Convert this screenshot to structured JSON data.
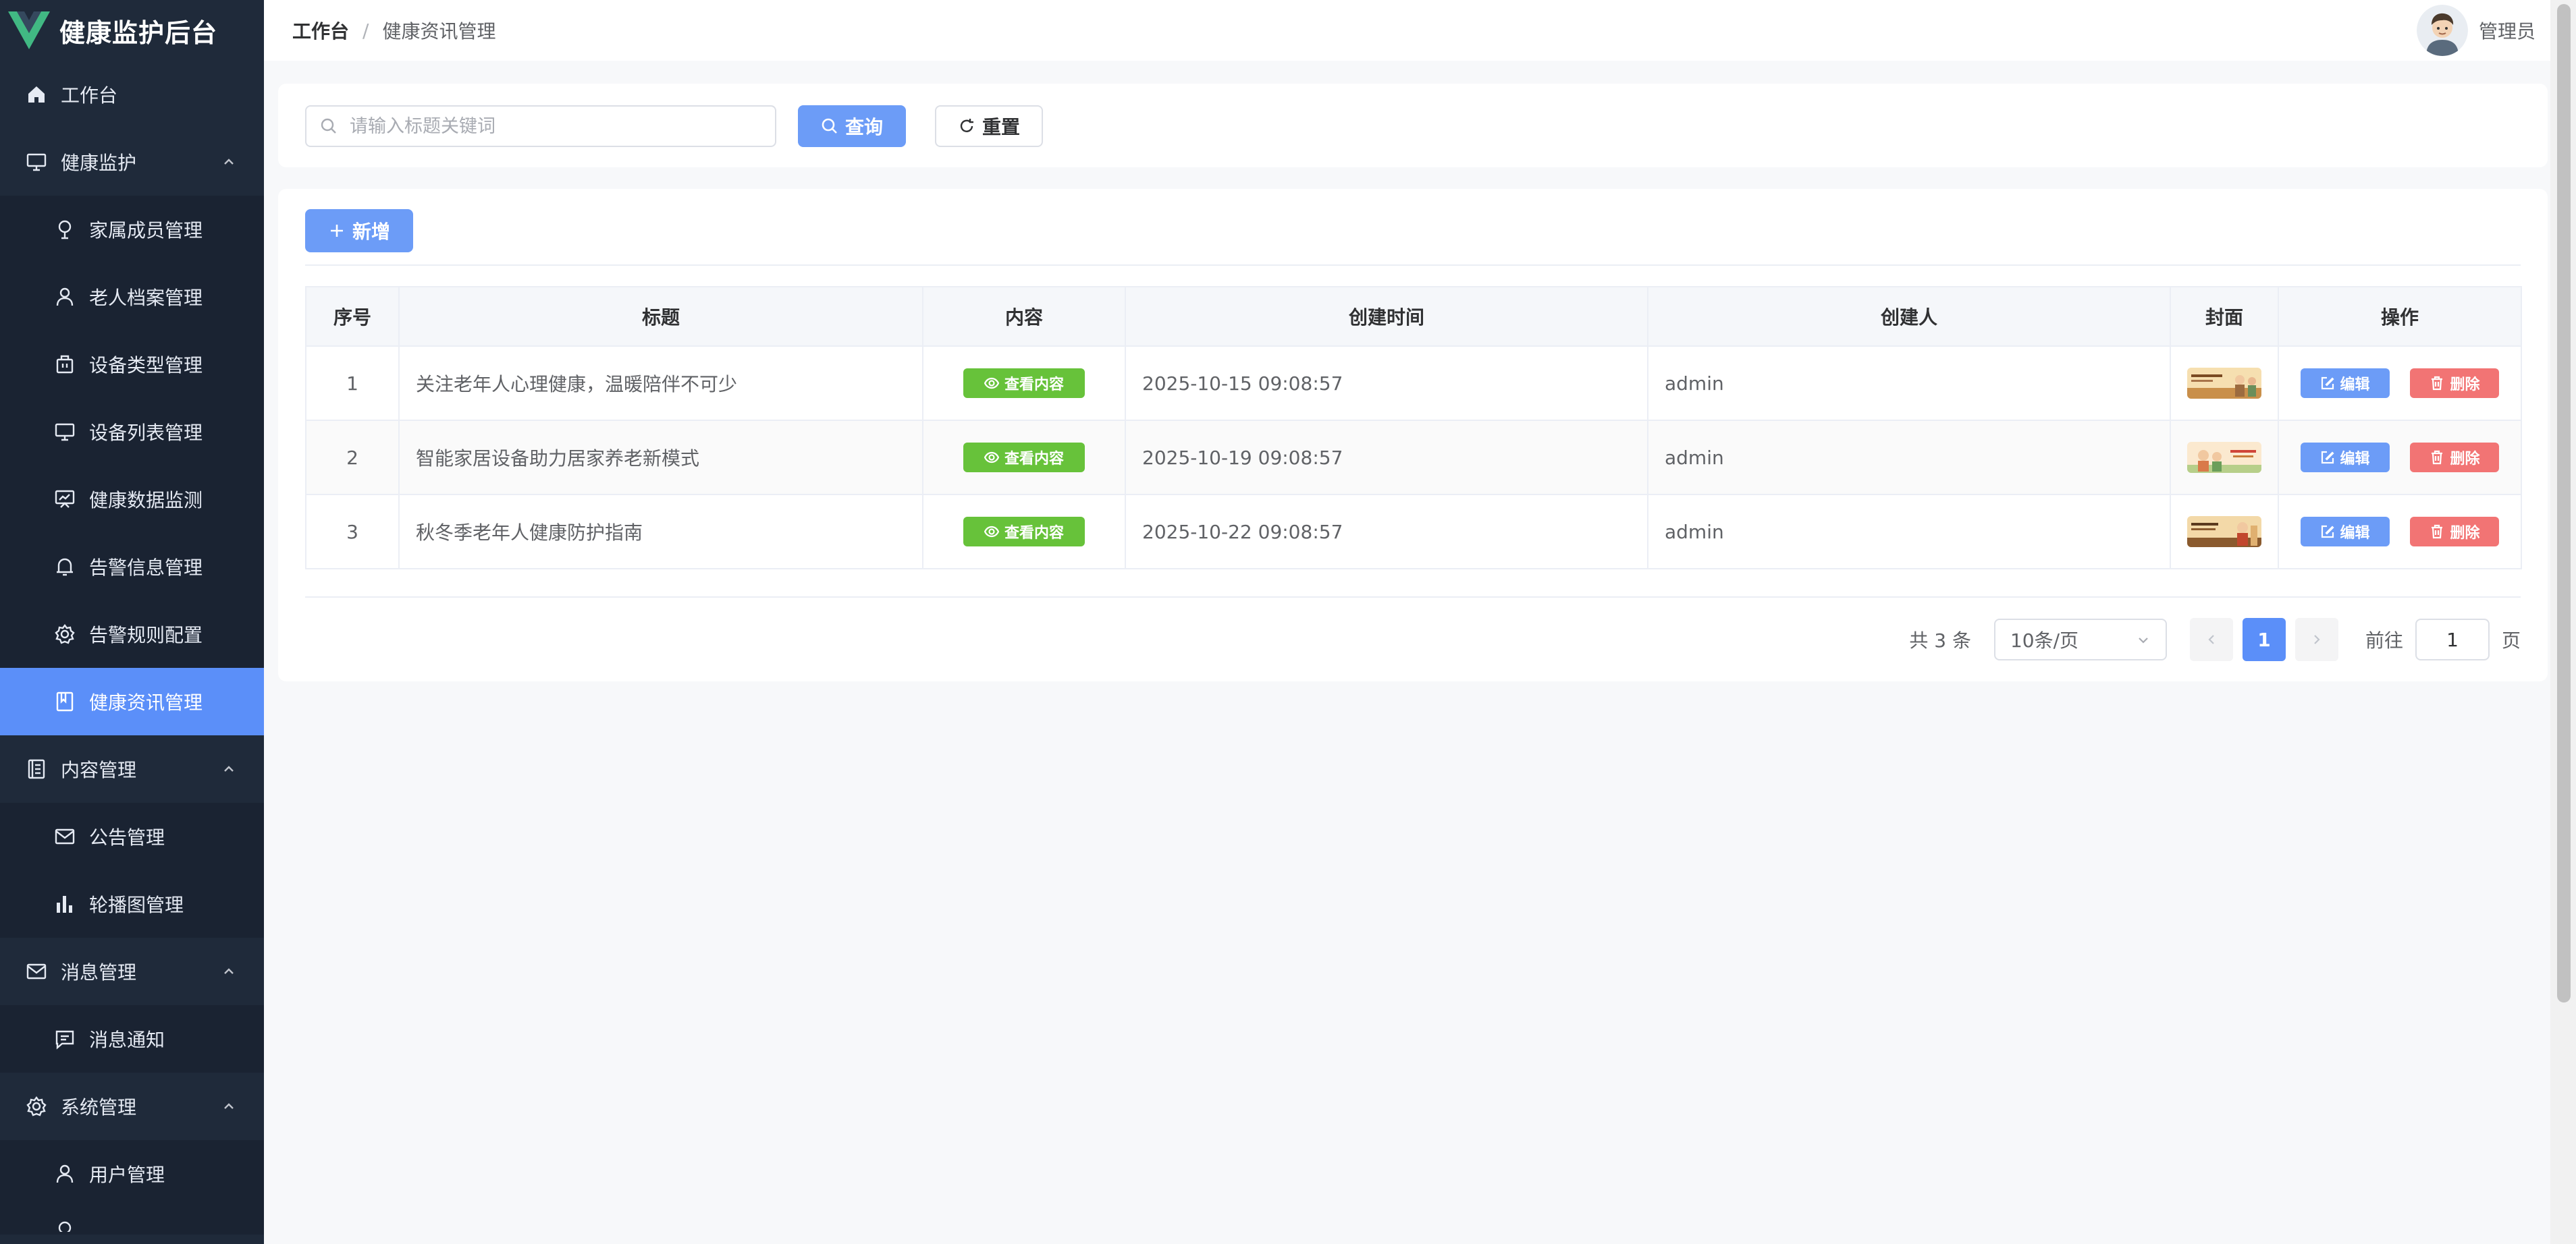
{
  "app": {
    "title": "健康监护后台"
  },
  "sidebar": {
    "items": [
      {
        "label": "工作台",
        "icon": "home-icon",
        "level": 1
      },
      {
        "label": "健康监护",
        "icon": "monitor-icon",
        "level": 1,
        "expanded": true
      },
      {
        "label": "家属成员管理",
        "icon": "location-pin-icon",
        "level": 2
      },
      {
        "label": "老人档案管理",
        "icon": "user-icon",
        "level": 2
      },
      {
        "label": "设备类型管理",
        "icon": "suitcase-icon",
        "level": 2
      },
      {
        "label": "设备列表管理",
        "icon": "monitor-icon",
        "level": 2
      },
      {
        "label": "健康数据监测",
        "icon": "data-board-icon",
        "level": 2
      },
      {
        "label": "告警信息管理",
        "icon": "bell-icon",
        "level": 2
      },
      {
        "label": "告警规则配置",
        "icon": "gear-icon",
        "level": 2
      },
      {
        "label": "健康资讯管理",
        "icon": "notebook-icon",
        "level": 2,
        "active": true
      },
      {
        "label": "内容管理",
        "icon": "document-icon",
        "level": 1,
        "expanded": true
      },
      {
        "label": "公告管理",
        "icon": "message-icon",
        "level": 2
      },
      {
        "label": "轮播图管理",
        "icon": "histogram-icon",
        "level": 2
      },
      {
        "label": "消息管理",
        "icon": "message-icon",
        "level": 1,
        "expanded": true
      },
      {
        "label": "消息通知",
        "icon": "chat-icon",
        "level": 2
      },
      {
        "label": "系统管理",
        "icon": "gear-icon",
        "level": 1,
        "expanded": true
      },
      {
        "label": "用户管理",
        "icon": "user-icon",
        "level": 2
      }
    ]
  },
  "header": {
    "breadcrumb_root": "工作台",
    "breadcrumb_separator": "/",
    "breadcrumb_current": "健康资讯管理",
    "user_name": "管理员"
  },
  "search": {
    "placeholder": "请输入标题关键词",
    "value": "",
    "query_label": "查询",
    "reset_label": "重置"
  },
  "toolbar": {
    "add_label": "新增"
  },
  "table": {
    "columns": [
      "序号",
      "标题",
      "内容",
      "创建时间",
      "创建人",
      "封面",
      "操作"
    ],
    "view_label": "查看内容",
    "edit_label": "编辑",
    "delete_label": "删除",
    "rows": [
      {
        "index": "1",
        "title": "关注老年人心理健康，温暖陪伴不可少",
        "created_at": "2025-10-15 09:08:57",
        "creator": "admin"
      },
      {
        "index": "2",
        "title": "智能家居设备助力居家养老新模式",
        "created_at": "2025-10-19 09:08:57",
        "creator": "admin"
      },
      {
        "index": "3",
        "title": "秋冬季老年人健康防护指南",
        "created_at": "2025-10-22 09:08:57",
        "creator": "admin"
      }
    ]
  },
  "pagination": {
    "total_text": "共 3 条",
    "page_size": "10条/页",
    "current_page": "1",
    "goto_label": "前往",
    "goto_value": "1",
    "goto_suffix": "页"
  },
  "colors": {
    "sidebar_bg": "#1f2a3a",
    "active": "#5b8ff9",
    "primary": "#6c9cf7",
    "success": "#67c23a",
    "danger": "#f27474"
  }
}
